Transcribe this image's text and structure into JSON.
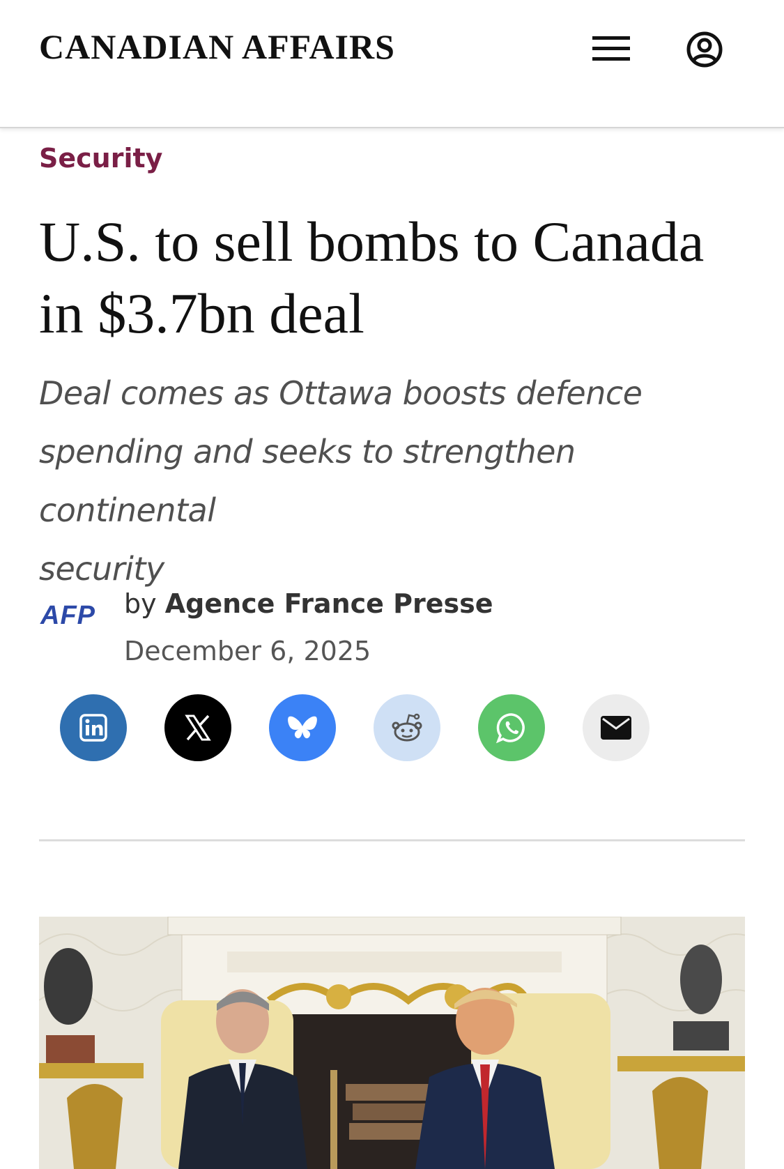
{
  "header": {
    "logo": "CANADIAN AFFAIRS",
    "menu_icon": "hamburger-menu-icon",
    "account_icon": "user-account-icon"
  },
  "article": {
    "category": "Security",
    "headline_line1": "U.S. to sell bombs to Canada",
    "headline_line2": "in $3.7bn deal",
    "subhead_line1": "Deal comes as Ottawa boosts defence",
    "subhead_line2": "spending and seeks to strengthen continental",
    "subhead_line3": "security",
    "source_logo": "AFP",
    "byline_prefix": "by",
    "author": "Agence France Presse",
    "date": "December 6, 2025"
  },
  "share_buttons": [
    {
      "name": "linkedin",
      "icon": "linkedin-icon",
      "color": "#2f6fb0"
    },
    {
      "name": "x",
      "icon": "x-icon",
      "color": "#000000"
    },
    {
      "name": "bluesky",
      "icon": "bluesky-icon",
      "color": "#3b82f6"
    },
    {
      "name": "reddit",
      "icon": "reddit-icon",
      "color": "#cfe0f5"
    },
    {
      "name": "whatsapp",
      "icon": "whatsapp-icon",
      "color": "#5cc46a"
    },
    {
      "name": "email",
      "icon": "email-icon",
      "color": "#ececec"
    }
  ],
  "colors": {
    "category": "#7a1f46",
    "afp": "#2c49a8"
  },
  "image": {
    "icon": "oval-office-photo"
  }
}
